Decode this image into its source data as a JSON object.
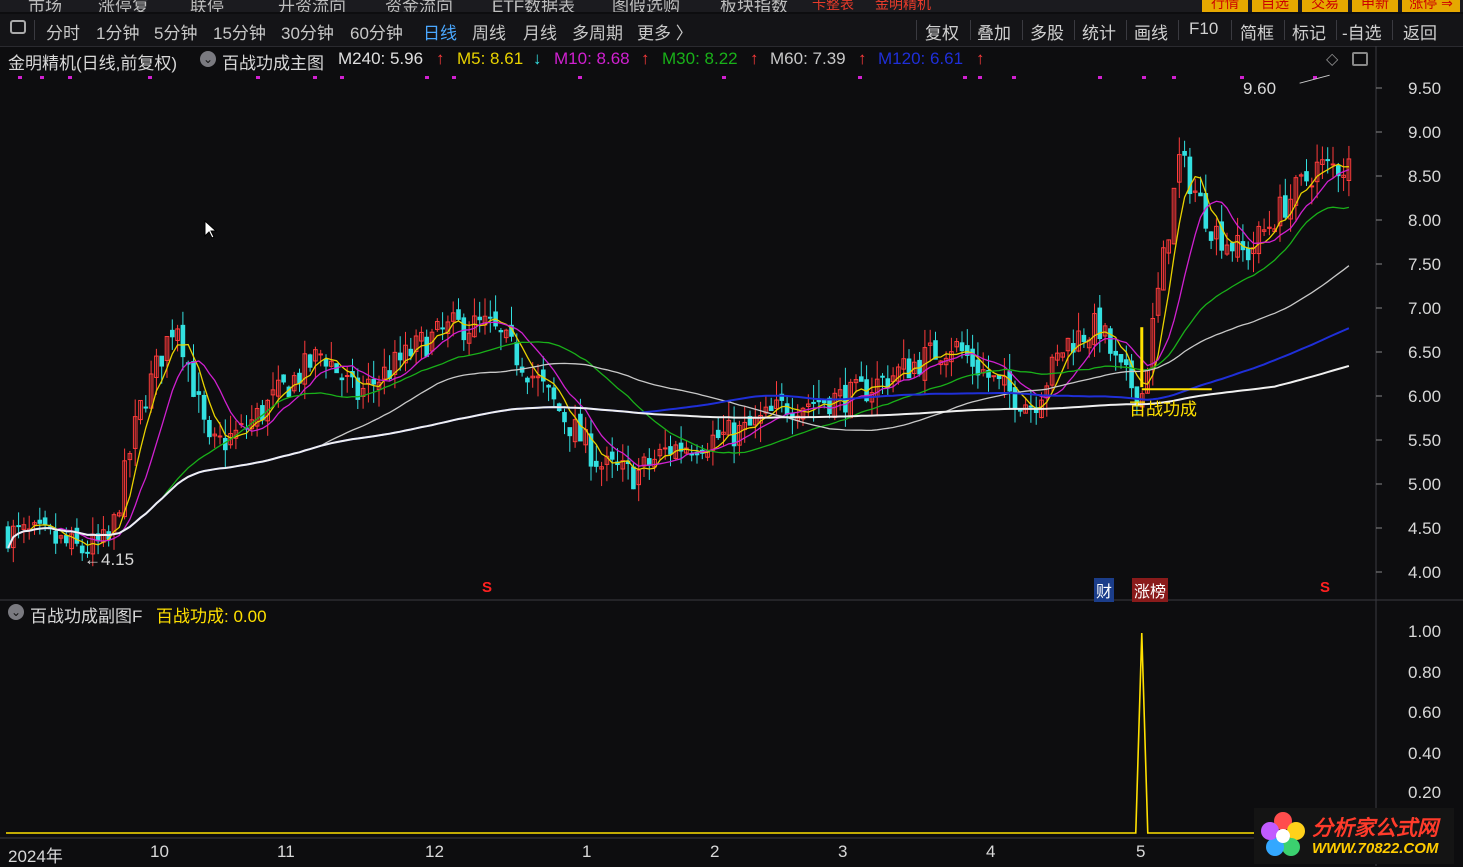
{
  "top_menu": {
    "items": [
      "市场",
      "涨停复",
      "联停",
      "开资流向",
      "资金流向",
      "ETF数据表",
      "图假选购",
      "板块指数"
    ],
    "red_items": [
      "卡整表",
      "金明精机"
    ],
    "right_buttons": [
      "行情",
      "自选",
      "交易",
      "申新",
      "涨停 ⇒"
    ]
  },
  "toolbar": {
    "periods": [
      "分时",
      "1分钟",
      "5分钟",
      "15分钟",
      "30分钟",
      "60分钟",
      "日线",
      "周线",
      "月线",
      "多周期",
      "更多 〉"
    ],
    "active_period": "日线",
    "right_buttons": [
      "复权",
      "叠加",
      "多股",
      "统计",
      "画线",
      "F10",
      "简框",
      "标记",
      "-自选",
      "返回"
    ]
  },
  "main_legend": {
    "title": "金明精机(日线,前复权)",
    "indicator": "百战功成主图",
    "m240": "M240: 5.96",
    "m5": "M5: 8.61",
    "m10": "M10: 8.68",
    "m30": "M30: 8.22",
    "m60": "M60: 7.39",
    "m120": "M120: 6.61",
    "arrow_up": "↑",
    "arrow_down": "↓"
  },
  "sub_legend": {
    "title": "百战功成副图F",
    "value": "百战功成: 0.00"
  },
  "annotations": {
    "high_label": "9.60",
    "low_label": "←4.15",
    "signal_label": "百战功成",
    "s_marker": "S",
    "cai_marker": "财",
    "zhangbang_marker": "涨榜"
  },
  "price_axis": [
    "9.50",
    "9.00",
    "8.50",
    "8.00",
    "7.50",
    "7.00",
    "6.50",
    "6.00",
    "5.50",
    "5.00",
    "4.50",
    "4.00"
  ],
  "sub_axis": [
    "1.00",
    "0.80",
    "0.60",
    "0.40",
    "0.20"
  ],
  "time_axis": [
    "2024年",
    "10",
    "11",
    "12",
    "1",
    "2",
    "3",
    "4",
    "5"
  ],
  "watermark": {
    "line1": "分析家公式网",
    "line2": "WWW.70822.COM"
  },
  "colors": {
    "up": "#ff3b3b",
    "down": "#33e0e0",
    "m5": "#e8d200",
    "m10": "#d020d0",
    "m30": "#19b019",
    "m60": "#c8c8c8",
    "m120": "#1f2fd8",
    "m240": "#f0f0f0",
    "signal": "#ffe000",
    "active_tab": "#4aa8ff"
  },
  "chart_data": [
    {
      "type": "candlestick",
      "title": "金明精机(日线,前复权)",
      "x_range": [
        "2024-09",
        "2025-05"
      ],
      "ylim": [
        3.9,
        9.7
      ],
      "annotated_high": 9.6,
      "annotated_low": 4.15,
      "close_path": [
        [
          "2024-09-02",
          4.45
        ],
        [
          "2024-09-10",
          4.4
        ],
        [
          "2024-09-18",
          4.25
        ],
        [
          "2024-09-24",
          4.35
        ],
        [
          "2024-09-30",
          5.8
        ],
        [
          "2024-10-08",
          6.9
        ],
        [
          "2024-10-15",
          5.4
        ],
        [
          "2024-10-22",
          5.6
        ],
        [
          "2024-10-31",
          6.1
        ],
        [
          "2024-11-08",
          6.5
        ],
        [
          "2024-11-15",
          6.0
        ],
        [
          "2024-11-22",
          6.3
        ],
        [
          "2024-11-29",
          6.6
        ],
        [
          "2024-12-06",
          6.8
        ],
        [
          "2024-12-13",
          6.8
        ],
        [
          "2024-12-20",
          6.4
        ],
        [
          "2024-12-27",
          5.9
        ],
        [
          "2025-01-06",
          5.2
        ],
        [
          "2025-01-13",
          5.1
        ],
        [
          "2025-01-20",
          5.4
        ],
        [
          "2025-02-05",
          5.6
        ],
        [
          "2025-02-14",
          5.9
        ],
        [
          "2025-02-21",
          5.95
        ],
        [
          "2025-02-28",
          6.0
        ],
        [
          "2025-03-07",
          6.2
        ],
        [
          "2025-03-14",
          6.4
        ],
        [
          "2025-03-21",
          6.6
        ],
        [
          "2025-03-31",
          6.1
        ],
        [
          "2025-04-07",
          5.9
        ],
        [
          "2025-04-14",
          6.6
        ],
        [
          "2025-04-21",
          6.8
        ],
        [
          "2025-04-25",
          6.3
        ],
        [
          "2025-04-30",
          6.0
        ],
        [
          "2025-05-08",
          8.7
        ],
        [
          "2025-05-15",
          7.9
        ],
        [
          "2025-05-22",
          7.6
        ],
        [
          "2025-05-29",
          8.1
        ],
        [
          "2025-06-06",
          8.6
        ],
        [
          "2025-06-13",
          8.61
        ]
      ],
      "moving_averages": [
        {
          "name": "M5",
          "last": 8.61
        },
        {
          "name": "M10",
          "last": 8.68
        },
        {
          "name": "M30",
          "last": 8.22
        },
        {
          "name": "M60",
          "last": 7.39
        },
        {
          "name": "M120",
          "last": 6.61
        },
        {
          "name": "M240",
          "last": 5.96
        }
      ],
      "signal": {
        "name": "百战功成",
        "date": "2025-04-30",
        "price": 6.1
      }
    },
    {
      "type": "line",
      "title": "百战功成副图F",
      "series": [
        {
          "name": "百战功成",
          "spike_date": "2025-04-30",
          "spike_value": 1.0,
          "last": 0.0
        }
      ],
      "ylim": [
        0,
        1.1
      ]
    }
  ]
}
